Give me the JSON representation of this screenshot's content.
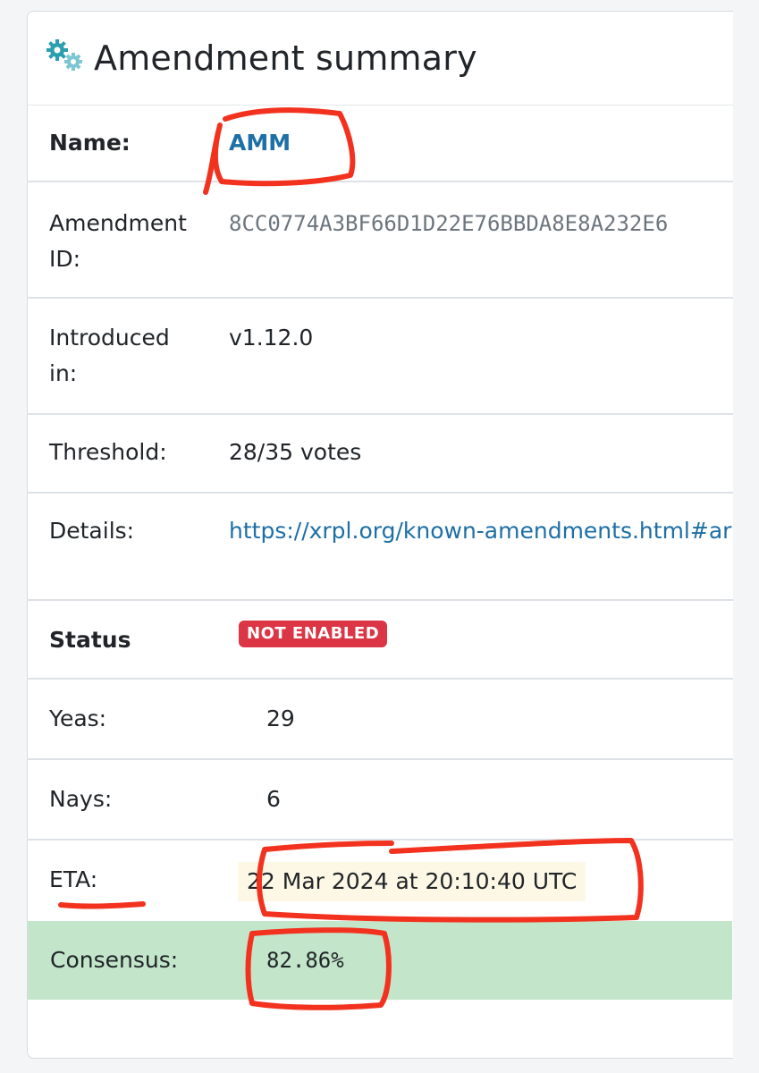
{
  "header": {
    "title": "Amendment summary",
    "icon": "cogs-icon"
  },
  "fields": {
    "name": {
      "label": "Name:",
      "value": "AMM"
    },
    "amendment_id": {
      "label_line1": "Amendment",
      "label_line2": "ID:",
      "value": "8CC0774A3BF66D1D22E76BBDA8E8A232E6"
    },
    "introduced_in": {
      "label_line1": "Introduced",
      "label_line2": "in:",
      "value": "v1.12.0"
    },
    "threshold": {
      "label": "Threshold:",
      "value": "28/35 votes"
    },
    "details": {
      "label": "Details:",
      "value": "https://xrpl.org/known-amendments.html#ar"
    }
  },
  "status": {
    "label": "Status",
    "badge": "NOT ENABLED",
    "yeas": {
      "label": "Yeas:",
      "value": "29"
    },
    "nays": {
      "label": "Nays:",
      "value": "6"
    },
    "eta": {
      "label": "ETA:",
      "value": "22 Mar 2024 at 20:10:40 UTC"
    },
    "consensus": {
      "label": "Consensus:",
      "value": "82.86%"
    }
  },
  "colors": {
    "accent_teal": "#2aa7b5",
    "link": "#1d6fa5",
    "badge_red": "#dc3545",
    "consensus_green": "#c3e6cb",
    "annotation_red": "#f2321e"
  }
}
